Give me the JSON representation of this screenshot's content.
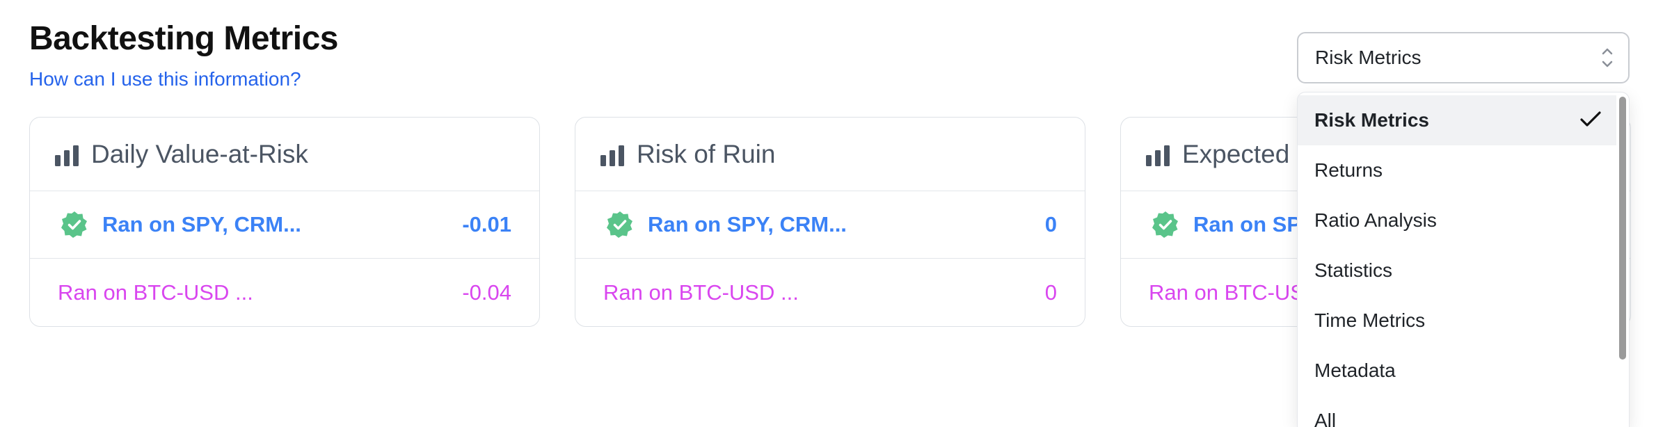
{
  "header": {
    "title": "Backtesting Metrics",
    "help_link": "How can I use this information?"
  },
  "cards": [
    {
      "title": "Daily Value-at-Risk",
      "rows": [
        {
          "label": "Ran on SPY, CRM...",
          "value": "-0.01"
        },
        {
          "label": "Ran on BTC-USD ...",
          "value": "-0.04"
        }
      ]
    },
    {
      "title": "Risk of Ruin",
      "rows": [
        {
          "label": "Ran on SPY, CRM...",
          "value": "0"
        },
        {
          "label": "Ran on BTC-USD ...",
          "value": "0"
        }
      ]
    },
    {
      "title": "Expected Shortfall",
      "rows": [
        {
          "label": "Ran on SPY, CRM...",
          "value": ""
        },
        {
          "label": "Ran on BTC-USD ...",
          "value": ""
        }
      ]
    }
  ],
  "metric_select": {
    "selected": "Risk Metrics",
    "options": [
      "Risk Metrics",
      "Returns",
      "Ratio Analysis",
      "Statistics",
      "Time Metrics",
      "Metadata",
      "All"
    ]
  },
  "icons": {
    "card_header": "bar-chart-icon",
    "verified": "verified-check-icon",
    "select_chevron": "chevron-up-down-icon",
    "selected_option": "checkmark-icon"
  },
  "colors": {
    "link": "#2563eb",
    "primary_run": "#3b82f6",
    "secondary_run": "#d946ef",
    "verified_badge": "#5ac48a"
  }
}
